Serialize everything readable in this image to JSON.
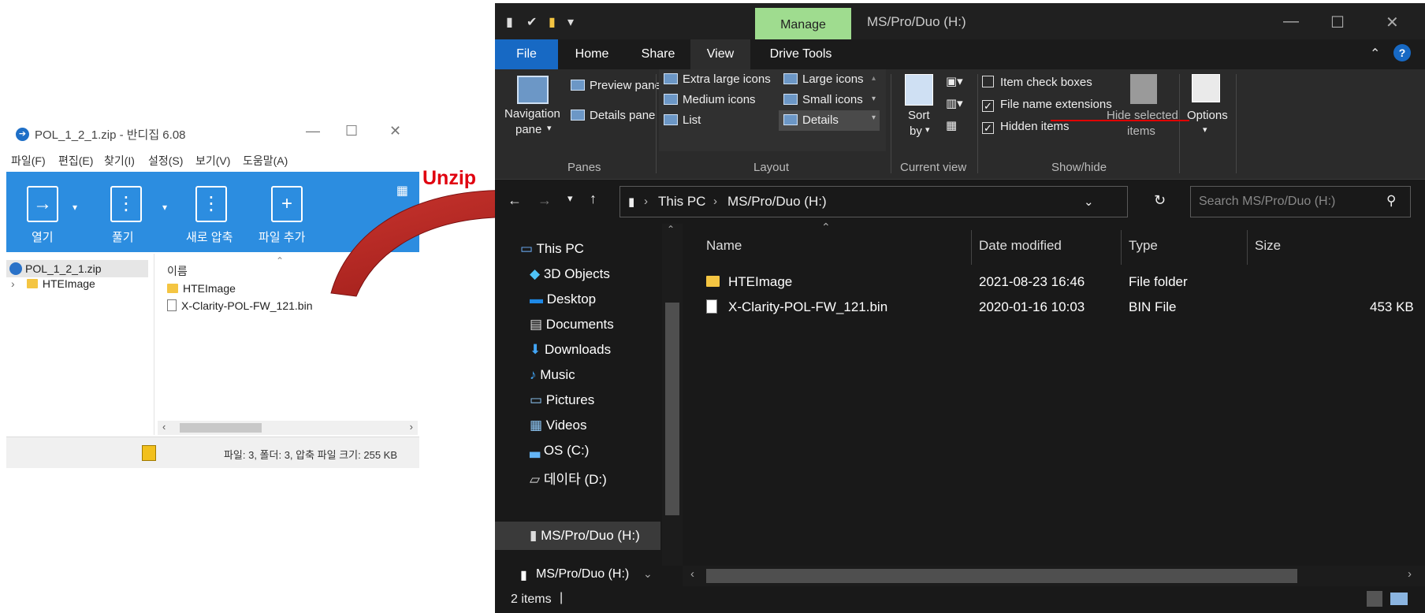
{
  "bandizip": {
    "title": "POL_1_2_1.zip - 반디집 6.08",
    "menu": [
      "파일(F)",
      "편집(E)",
      "찾기(I)",
      "설정(S)",
      "보기(V)",
      "도움말(A)"
    ],
    "tools": [
      "열기",
      "풀기",
      "새로 압축",
      "파일 추가"
    ],
    "tree": [
      "POL_1_2_1.zip",
      "HTEImage"
    ],
    "column_name": "이름",
    "files": [
      "HTEImage",
      "X-Clarity-POL-FW_121.bin"
    ],
    "status": "파일: 3, 폴더: 3, 압축 파일 크기: 255 KB"
  },
  "annotation": {
    "label": "Unzip",
    "color": "#e0000f"
  },
  "explorer": {
    "context_tab": "Manage",
    "window_title": "MS/Pro/Duo (H:)",
    "tabs": [
      "File",
      "Home",
      "Share",
      "View",
      "Drive Tools"
    ],
    "ribbon": {
      "navigation_pane": "Navigation",
      "navigation_pane2": "pane",
      "preview_pane": "Preview pane",
      "details_pane": "Details pane",
      "panes_group": "Panes",
      "layouts": [
        "Extra large icons",
        "Large icons",
        "Medium icons",
        "Small icons",
        "List",
        "Details"
      ],
      "layout_group": "Layout",
      "sort_by": "Sort",
      "sort_by2": "by",
      "current_view_group": "Current view",
      "item_check_boxes": "Item check boxes",
      "file_name_extensions": "File name extensions",
      "hidden_items": "Hidden items",
      "hide_selected": "Hide selected",
      "hide_selected2": "items",
      "show_hide_group": "Show/hide",
      "options": "Options"
    },
    "address": [
      "This PC",
      "MS/Pro/Duo (H:)"
    ],
    "search_placeholder": "Search MS/Pro/Duo (H:)",
    "nav": [
      "This PC",
      "3D Objects",
      "Desktop",
      "Documents",
      "Downloads",
      "Music",
      "Pictures",
      "Videos",
      "OS (C:)",
      "데이타 (D:)",
      "MS/Pro/Duo (H:)"
    ],
    "nav_bottom": "MS/Pro/Duo (H:)",
    "columns": [
      "Name",
      "Date modified",
      "Type",
      "Size"
    ],
    "rows": [
      {
        "name": "HTEImage",
        "date": "2021-08-23 16:46",
        "type": "File folder",
        "size": ""
      },
      {
        "name": "X-Clarity-POL-FW_121.bin",
        "date": "2020-01-16 10:03",
        "type": "BIN File",
        "size": "453 KB"
      }
    ],
    "status": "2 items",
    "colors": {
      "file_tab": "#1769c4",
      "manage_tab": "#9fdc8f",
      "background": "#191919"
    }
  }
}
